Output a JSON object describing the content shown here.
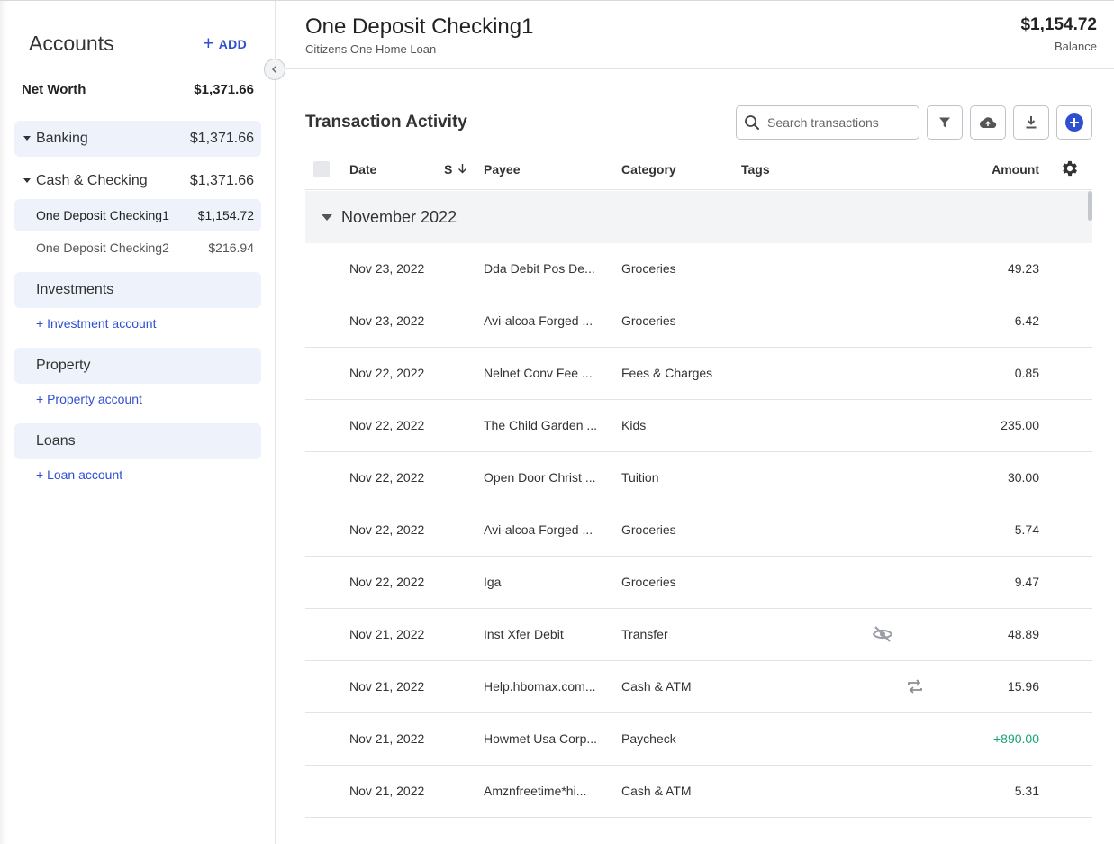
{
  "sidebar": {
    "title": "Accounts",
    "add_label": "ADD",
    "net_worth_label": "Net Worth",
    "net_worth_value": "$1,371.66",
    "banking": {
      "label": "Banking",
      "value": "$1,371.66"
    },
    "cash_checking": {
      "label": "Cash & Checking",
      "value": "$1,371.66"
    },
    "accounts": [
      {
        "label": "One Deposit Checking1",
        "value": "$1,154.72"
      },
      {
        "label": "One Deposit Checking2",
        "value": "$216.94"
      }
    ],
    "investments": {
      "label": "Investments",
      "add": "+ Investment account"
    },
    "property": {
      "label": "Property",
      "add": "+ Property account"
    },
    "loans": {
      "label": "Loans",
      "add": "+ Loan account"
    }
  },
  "header": {
    "title": "One Deposit Checking1",
    "subtitle": "Citizens One Home Loan",
    "balance_value": "$1,154.72",
    "balance_label": "Balance"
  },
  "activity": {
    "title": "Transaction Activity",
    "search_placeholder": "Search transactions",
    "columns": {
      "date": "Date",
      "status": "S",
      "payee": "Payee",
      "category": "Category",
      "tags": "Tags",
      "amount": "Amount"
    },
    "month": "November 2022",
    "rows": [
      {
        "date": "Nov 23, 2022",
        "payee": "Dda Debit Pos De...",
        "category": "Groceries",
        "amount": "49.23",
        "icon": ""
      },
      {
        "date": "Nov 23, 2022",
        "payee": "Avi-alcoa Forged ...",
        "category": "Groceries",
        "amount": "6.42",
        "icon": ""
      },
      {
        "date": "Nov 22, 2022",
        "payee": "Nelnet Conv Fee ...",
        "category": "Fees & Charges",
        "amount": "0.85",
        "icon": ""
      },
      {
        "date": "Nov 22, 2022",
        "payee": "The Child Garden ...",
        "category": "Kids",
        "amount": "235.00",
        "icon": ""
      },
      {
        "date": "Nov 22, 2022",
        "payee": "Open Door Christ ...",
        "category": "Tuition",
        "amount": "30.00",
        "icon": ""
      },
      {
        "date": "Nov 22, 2022",
        "payee": "Avi-alcoa Forged ...",
        "category": "Groceries",
        "amount": "5.74",
        "icon": ""
      },
      {
        "date": "Nov 22, 2022",
        "payee": "Iga",
        "category": "Groceries",
        "amount": "9.47",
        "icon": ""
      },
      {
        "date": "Nov 21, 2022",
        "payee": "Inst Xfer Debit",
        "category": "Transfer",
        "amount": "48.89",
        "icon": "hidden-icon"
      },
      {
        "date": "Nov 21, 2022",
        "payee": "Help.hbomax.com...",
        "category": "Cash & ATM",
        "amount": "15.96",
        "icon": "repeat-icon"
      },
      {
        "date": "Nov 21, 2022",
        "payee": "Howmet Usa Corp...",
        "category": "Paycheck",
        "amount": "+890.00",
        "icon": ""
      },
      {
        "date": "Nov 21, 2022",
        "payee": "Amznfreetime*hi...",
        "category": "Cash & ATM",
        "amount": "5.31",
        "icon": ""
      }
    ]
  },
  "colors": {
    "accent": "#2f4fd1",
    "positive": "#1aa37a",
    "group_bg": "#edf2fb"
  }
}
